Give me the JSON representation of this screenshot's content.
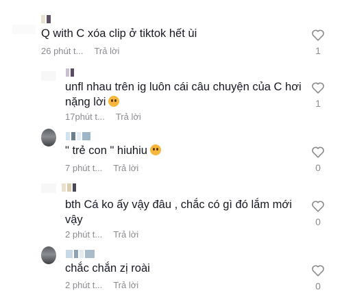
{
  "comments": [
    {
      "text": "Q with C xóa clip ở tiktok hết ùi",
      "time": "26 phút t...",
      "reply": "Trả lời",
      "likes": "1",
      "emoji": false
    },
    {
      "text": "unfl nhau trên ig luôn cái câu chuyện của C hơi nặng lời",
      "time": "17phút t...",
      "reply": "Trả lời",
      "likes": "1",
      "emoji": true
    },
    {
      "text": "\" trẻ con \" hiuhiu",
      "time": "7 phút t...",
      "reply": "Trả lời",
      "likes": "0",
      "emoji": true
    },
    {
      "text": "bth Cá ko ấy vậy đâu , chắc có gì đó lắm mới vậy",
      "time": "2 phút t...",
      "reply": "Trả lời",
      "likes": "0",
      "emoji": false
    },
    {
      "text": "chắc chắn zị roài",
      "time": "2 phút t...",
      "reply": "Trả lời",
      "likes": "0",
      "emoji": false
    }
  ],
  "colors": {
    "text": "#161823",
    "meta": "#8a8b91",
    "icon": "#8a8b91"
  },
  "icons": {
    "like": "heart-outline-icon",
    "emoji": "face-emoji-icon"
  }
}
